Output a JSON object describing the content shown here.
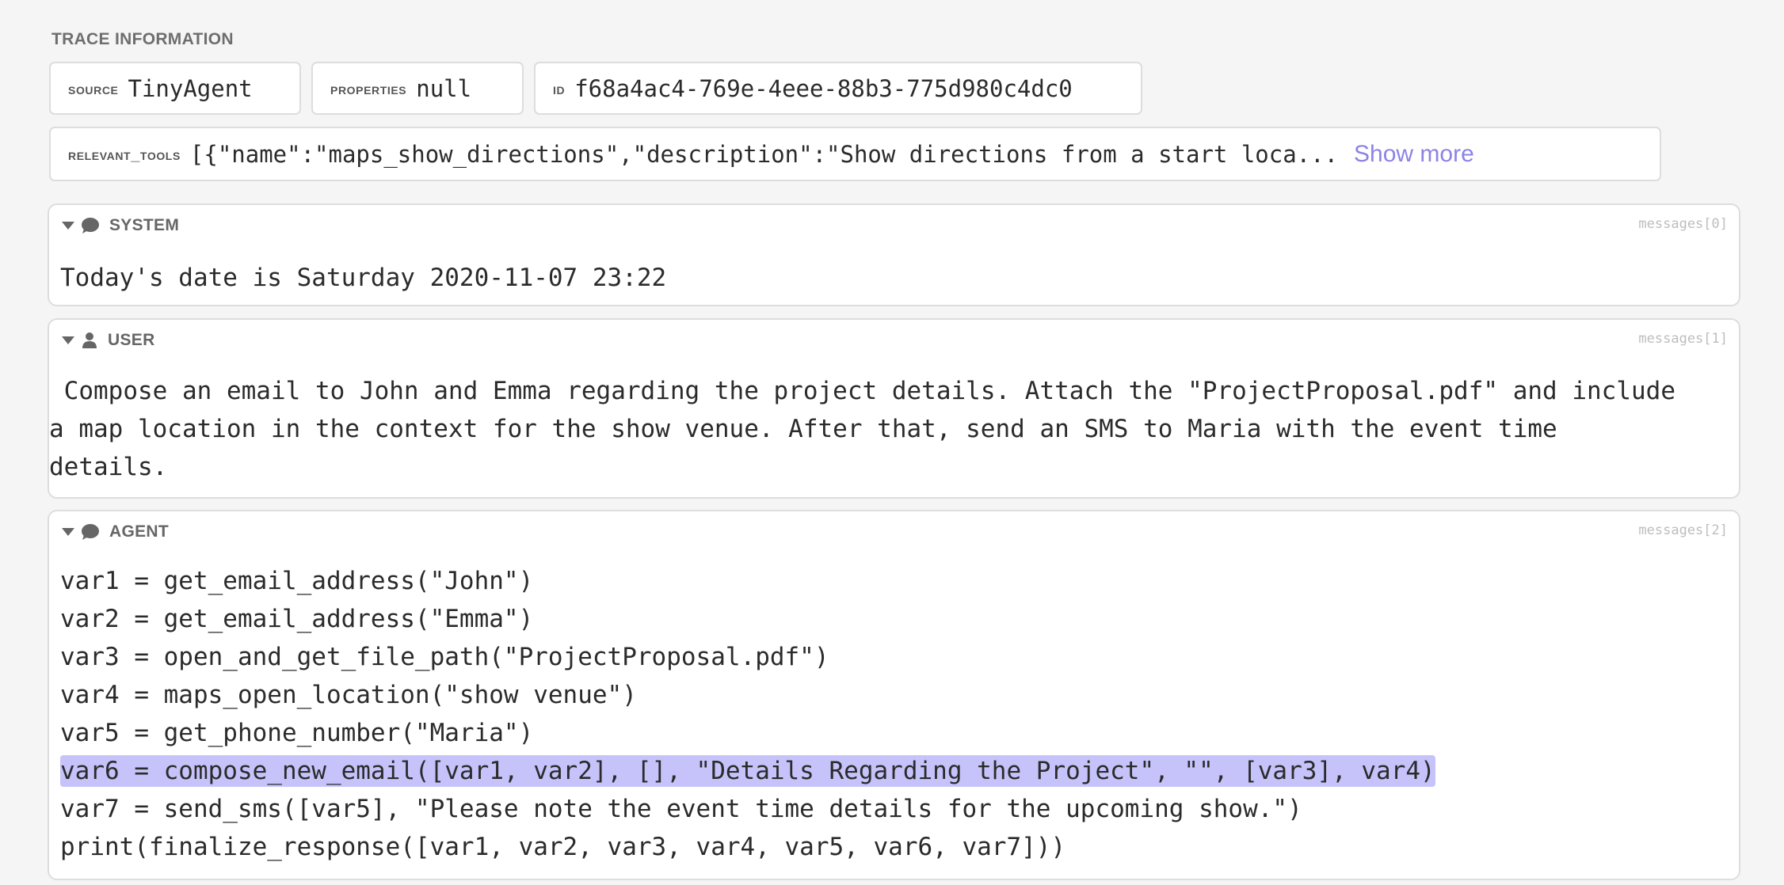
{
  "trace_info": {
    "title": "TRACE INFORMATION",
    "fields": {
      "source": {
        "key": "source",
        "value": "TinyAgent"
      },
      "properties": {
        "key": "properties",
        "value": "null"
      },
      "id": {
        "key": "id",
        "value": "f68a4ac4-769e-4eee-88b3-775d980c4dc0"
      },
      "relevant_tools": {
        "key": "relevant_tools",
        "value": "[{\"name\":\"maps_show_directions\",\"description\":\"Show directions from a start loca...",
        "show_more_label": "Show more"
      }
    }
  },
  "messages": [
    {
      "role": "SYSTEM",
      "icon": "speech-bubble-icon",
      "index_label": "messages[0]",
      "content": "Today's date is Saturday 2020-11-07 23:22"
    },
    {
      "role": "USER",
      "icon": "user-icon",
      "index_label": "messages[1]",
      "content": " Compose an email to John and Emma regarding the project details. Attach the \"ProjectProposal.pdf\" and include\na map location in the context for the show venue. After that, send an SMS to Maria with the event time\ndetails."
    },
    {
      "role": "AGENT",
      "icon": "speech-bubble-icon",
      "index_label": "messages[2]",
      "lines": [
        "var1 = get_email_address(\"John\")",
        "var2 = get_email_address(\"Emma\")",
        "var3 = open_and_get_file_path(\"ProjectProposal.pdf\")",
        "var4 = maps_open_location(\"show venue\")",
        "var5 = get_phone_number(\"Maria\")",
        "var6 = compose_new_email([var1, var2], [], \"Details Regarding the Project\", \"\", [var3], var4)",
        "var7 = send_sms([var5], \"Please note the event time details for the upcoming show.\")",
        "print(finalize_response([var1, var2, var3, var4, var5, var6, var7]))"
      ],
      "highlighted_line": 5
    }
  ],
  "colors": {
    "highlight": "#c6c3fb",
    "link": "#8c83e6"
  }
}
